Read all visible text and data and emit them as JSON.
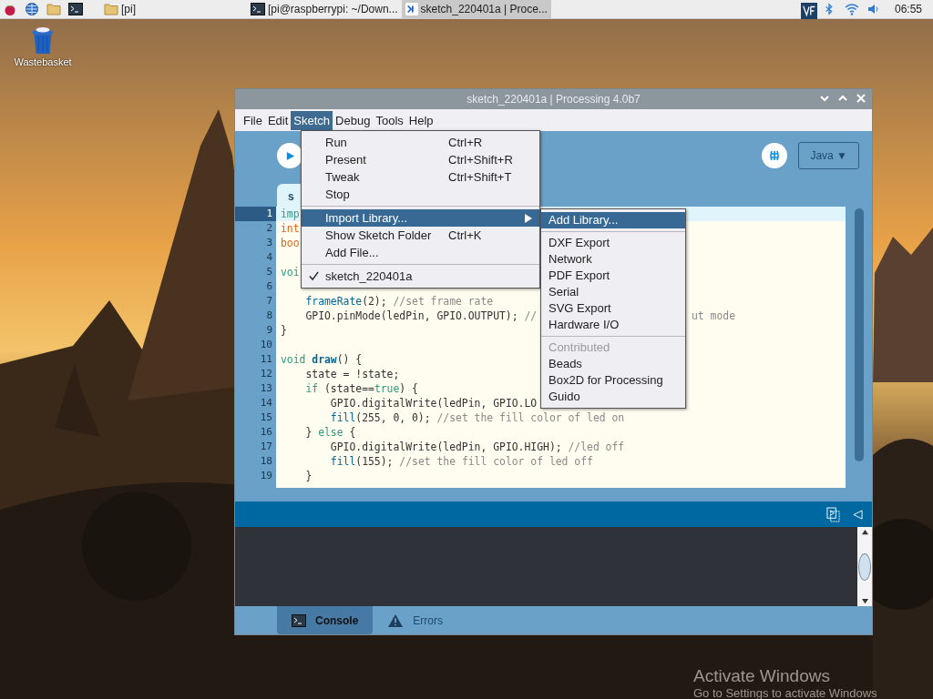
{
  "taskbar": {
    "launchers": [
      {
        "kind": "raspberry"
      },
      {
        "kind": "globe"
      },
      {
        "kind": "folder"
      },
      {
        "kind": "terminal"
      }
    ],
    "tasks": [
      {
        "label": "[pi]",
        "selected": false
      },
      {
        "label": "[pi@raspberrypi: ~/Down...",
        "selected": false
      },
      {
        "label": "sketch_220401a | Proce...",
        "selected": true
      }
    ],
    "tray": [
      {
        "kind": "vnc"
      },
      {
        "kind": "bluetooth"
      },
      {
        "kind": "wifi"
      },
      {
        "kind": "volume"
      }
    ],
    "clock": "06:55"
  },
  "desktop_icons": [
    {
      "label": "Wastebasket"
    }
  ],
  "window": {
    "title": "sketch_220401a | Processing 4.0b7",
    "menus": [
      {
        "label": "File",
        "selected": false
      },
      {
        "label": "Edit",
        "selected": false
      },
      {
        "label": "Sketch",
        "selected": true
      },
      {
        "label": "Debug",
        "selected": false
      },
      {
        "label": "Tools",
        "selected": false
      },
      {
        "label": "Help",
        "selected": false
      }
    ],
    "mode": "Java ▼",
    "tabs": [
      {
        "label": "s",
        "selected": true
      }
    ],
    "code": [
      {
        "number": "1",
        "current": true,
        "segments": [
          {
            "text": "imp",
            "kind": "keyword"
          }
        ]
      },
      {
        "number": "2",
        "current": false,
        "segments": [
          {
            "text": "int",
            "kind": "type"
          }
        ]
      },
      {
        "number": "3",
        "current": false,
        "segments": [
          {
            "text": "boo",
            "kind": "type"
          }
        ]
      },
      {
        "number": "4",
        "current": false
      },
      {
        "number": "5",
        "current": false,
        "segments": [
          {
            "text": "voi",
            "kind": "keyword"
          }
        ],
        "children": [
          {
            "number": "6",
            "current": false
          },
          {
            "number": "7",
            "current": false,
            "segments": [
              {
                "text": "frameRate",
                "kind": "function"
              },
              {
                "text": "(2); ",
                "kind": "plain"
              },
              {
                "text": "//set frame rate",
                "kind": "comment"
              }
            ]
          },
          {
            "number": "8",
            "current": false,
            "segments": [
              {
                "text": "GPIO.pinMode(ledPin, GPIO.OUTPUT); ",
                "kind": "plain"
              },
              {
                "text": "//",
                "kind": "comment"
              }
            ],
            "tail": "ut mode"
          }
        ]
      },
      {
        "number": "9",
        "current": false,
        "segments": [
          {
            "text": "}",
            "kind": "plain"
          }
        ]
      },
      {
        "number": "10",
        "current": false
      },
      {
        "number": "11",
        "current": false,
        "segments": [
          {
            "text": "void ",
            "kind": "keyword"
          },
          {
            "text": "draw",
            "kind": "definition"
          },
          {
            "text": "() {",
            "kind": "plain"
          }
        ],
        "children": [
          {
            "number": "12",
            "current": false,
            "segments": [
              {
                "text": "state = !state;",
                "kind": "plain"
              }
            ]
          },
          {
            "number": "13",
            "current": false,
            "segments": [
              {
                "text": "if",
                "kind": "keyword"
              },
              {
                "text": " (state==",
                "kind": "plain"
              },
              {
                "text": "true",
                "kind": "keyword"
              },
              {
                "text": ") {",
                "kind": "plain"
              }
            ],
            "children": [
              {
                "number": "14",
                "current": false,
                "segments": [
                  {
                    "text": "GPIO.digitalWrite(ledPin, GPIO.LO",
                    "kind": "plain"
                  }
                ]
              },
              {
                "number": "15",
                "current": false,
                "segments": [
                  {
                    "text": "fill",
                    "kind": "function"
                  },
                  {
                    "text": "(255, 0, 0); ",
                    "kind": "plain"
                  },
                  {
                    "text": "//set the fill color of led on",
                    "kind": "comment"
                  }
                ]
              }
            ]
          },
          {
            "number": "16",
            "current": false,
            "segments": [
              {
                "text": "} ",
                "kind": "plain"
              },
              {
                "text": "else",
                "kind": "keyword"
              },
              {
                "text": " {",
                "kind": "plain"
              }
            ],
            "children": [
              {
                "number": "17",
                "current": false,
                "segments": [
                  {
                    "text": "GPIO.digitalWrite(ledPin, GPIO.HIGH); ",
                    "kind": "plain"
                  },
                  {
                    "text": "//led off",
                    "kind": "comment"
                  }
                ]
              },
              {
                "number": "18",
                "current": false,
                "segments": [
                  {
                    "text": "fill",
                    "kind": "function"
                  },
                  {
                    "text": "(155); ",
                    "kind": "plain"
                  },
                  {
                    "text": "//set the fill color of led off",
                    "kind": "comment"
                  }
                ]
              }
            ]
          },
          {
            "number": "19",
            "current": false,
            "segments": [
              {
                "text": "}",
                "kind": "plain"
              }
            ]
          }
        ]
      }
    ],
    "console_tabs": [
      {
        "label": "Console",
        "selected": true
      },
      {
        "label": "Errors",
        "selected": false
      }
    ]
  },
  "sketch_menu": [
    {
      "kind": "item",
      "label": "Run",
      "shortcut": "Ctrl+R",
      "selected": false
    },
    {
      "kind": "item",
      "label": "Present",
      "shortcut": "Ctrl+Shift+R",
      "selected": false
    },
    {
      "kind": "item",
      "label": "Tweak",
      "shortcut": "Ctrl+Shift+T",
      "selected": false
    },
    {
      "kind": "item",
      "label": "Stop",
      "selected": false
    },
    {
      "kind": "separator"
    },
    {
      "kind": "submenu",
      "label": "Import Library...",
      "selected": true
    },
    {
      "kind": "item",
      "label": "Show Sketch Folder",
      "shortcut": "Ctrl+K",
      "selected": false
    },
    {
      "kind": "item",
      "label": "Add File...",
      "selected": false
    },
    {
      "kind": "separator"
    },
    {
      "kind": "check",
      "label": "sketch_220401a",
      "checked": true,
      "selected": false
    }
  ],
  "library_menu": [
    {
      "kind": "item",
      "label": "Add Library...",
      "selected": true,
      "disabled": false
    },
    {
      "kind": "separator"
    },
    {
      "kind": "item",
      "label": "DXF Export",
      "selected": false,
      "disabled": false
    },
    {
      "kind": "item",
      "label": "Network",
      "selected": false,
      "disabled": false
    },
    {
      "kind": "item",
      "label": "PDF Export",
      "selected": false,
      "disabled": false
    },
    {
      "kind": "item",
      "label": "Serial",
      "selected": false,
      "disabled": false
    },
    {
      "kind": "item",
      "label": "SVG Export",
      "selected": false,
      "disabled": false
    },
    {
      "kind": "item",
      "label": "Hardware I/O",
      "selected": false,
      "disabled": false
    },
    {
      "kind": "separator"
    },
    {
      "kind": "item",
      "label": "Contributed",
      "selected": false,
      "disabled": true
    },
    {
      "kind": "item",
      "label": "Beads",
      "selected": false,
      "disabled": false
    },
    {
      "kind": "item",
      "label": "Box2D for Processing",
      "selected": false,
      "disabled": false
    },
    {
      "kind": "item",
      "label": "Guido",
      "selected": false,
      "disabled": false
    }
  ],
  "activation_notice": {
    "title": "Activate Windows",
    "text": "Go to Settings to activate Windows"
  }
}
